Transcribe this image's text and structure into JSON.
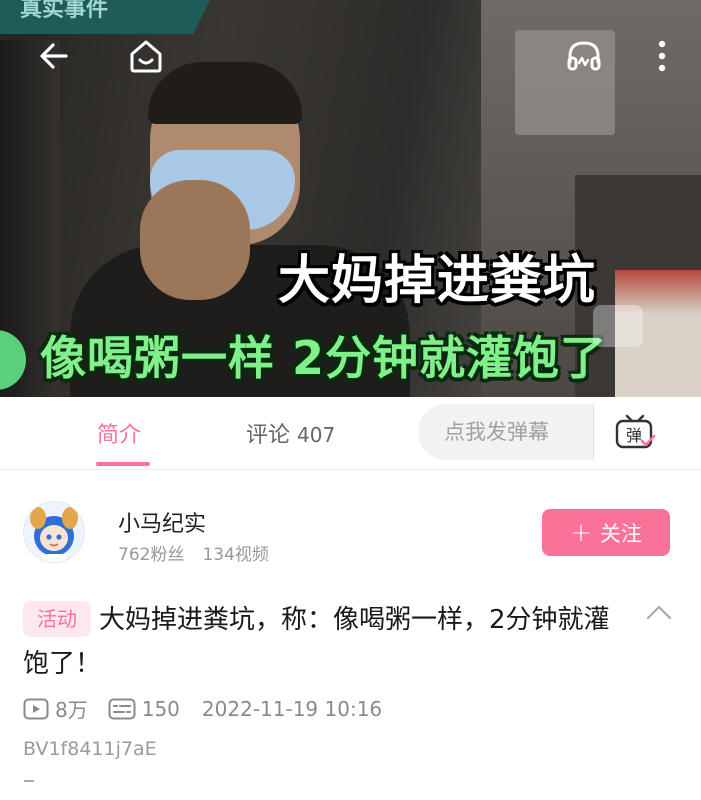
{
  "video": {
    "top_strip_text": "真实事件",
    "caption_line1": "大妈掉进粪坑",
    "caption_line2": "像喝粥一样 2分钟就灌饱了",
    "buttons": {
      "back": "back-arrow-icon",
      "home": "home-icon",
      "listen": "headphones-icon",
      "more": "more-dots-icon"
    }
  },
  "tabs": {
    "intro": "简介",
    "comments": "评论",
    "comments_count": "407",
    "active": "intro"
  },
  "danmaku": {
    "placeholder": "点我发弹幕",
    "button_label": "弹"
  },
  "uploader": {
    "name": "小马纪实",
    "fans": "762粉丝",
    "videos": "134视频",
    "follow_label": "关注"
  },
  "post": {
    "tag": "活动",
    "title": "大妈掉进粪坑，称：像喝粥一样，2分钟就灌饱了！",
    "views": "8万",
    "danmaku_count": "150",
    "datetime": "2022-11-19 10:16",
    "bvid": "BV1f8411j7aE"
  },
  "colors": {
    "accent": "#fb7299",
    "tag_bg": "#fde8ef",
    "caption_green": "#7ff08a"
  }
}
